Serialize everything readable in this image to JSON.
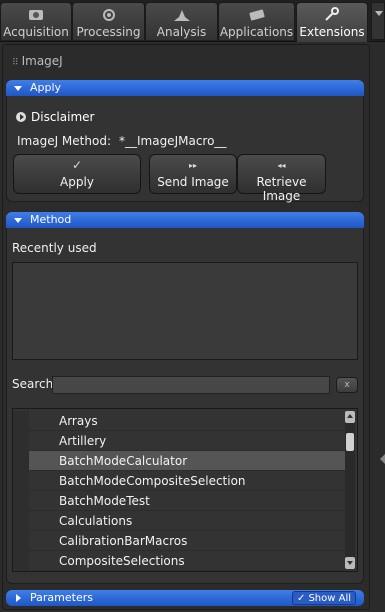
{
  "tabs": [
    {
      "label": "Acquisition",
      "icon": "acquisition-icon"
    },
    {
      "label": "Processing",
      "icon": "processing-icon"
    },
    {
      "label": "Analysis",
      "icon": "analysis-icon"
    },
    {
      "label": "Applications",
      "icon": "applications-icon"
    },
    {
      "label": "Extensions",
      "icon": "extensions-icon",
      "active": true
    }
  ],
  "section_title": "ImageJ",
  "apply_panel": {
    "title": "Apply",
    "disclaimer": "Disclaimer",
    "method_label": "ImageJ Method:",
    "method_value": "*__ImageJMacro__",
    "apply_button": "Apply",
    "apply_icon": "✓",
    "send_button": "Send Image",
    "send_icon": "▸▸",
    "retrieve_button": "Retrieve Image",
    "retrieve_icon": "◂◂"
  },
  "method_panel": {
    "title": "Method",
    "recently_used": "Recently used",
    "search_label": "Search",
    "search_value": "",
    "clear_label": "x",
    "items": [
      {
        "label": "Arrays"
      },
      {
        "label": "Artillery"
      },
      {
        "label": "BatchModeCalculator",
        "selected": true
      },
      {
        "label": "BatchModeCompositeSelection"
      },
      {
        "label": "BatchModeTest"
      },
      {
        "label": "Calculations"
      },
      {
        "label": "CalibrationBarMacros"
      },
      {
        "label": "CompositeSelections"
      }
    ]
  },
  "parameters_panel": {
    "title": "Parameters",
    "show_all": "Show All",
    "show_all_checked": true
  },
  "colors": {
    "panel_header": "#2f6ad8",
    "background": "#2b2b2b"
  }
}
